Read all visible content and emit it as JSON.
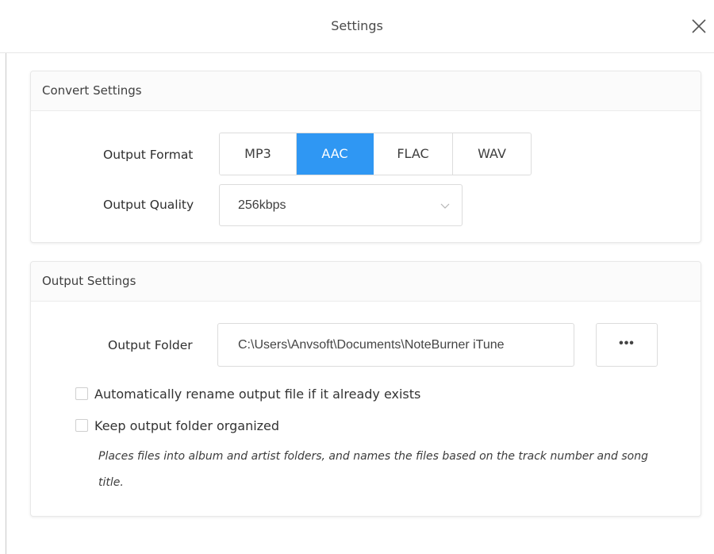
{
  "window": {
    "title": "Settings",
    "close_icon": "close-icon"
  },
  "convert_settings": {
    "header": "Convert Settings",
    "output_format_label": "Output Format",
    "formats": [
      "MP3",
      "AAC",
      "FLAC",
      "WAV"
    ],
    "selected_format": "AAC",
    "output_quality_label": "Output Quality",
    "output_quality_value": "256kbps",
    "dropdown_icon": "chevron-down-icon"
  },
  "output_settings": {
    "header": "Output Settings",
    "output_folder_label": "Output Folder",
    "output_folder_value": "C:\\Users\\Anvsoft\\Documents\\NoteBurner iTune",
    "browse_label": "•••",
    "auto_rename_label": "Automatically rename output file if it already exists",
    "auto_rename_checked": false,
    "keep_organized_label": "Keep output folder organized",
    "keep_organized_checked": false,
    "hint": "Places files into album and artist folders, and names the files based on the track number and song title."
  },
  "colors": {
    "accent": "#2f97f3",
    "border": "#dcdcdc",
    "text": "#333333"
  }
}
